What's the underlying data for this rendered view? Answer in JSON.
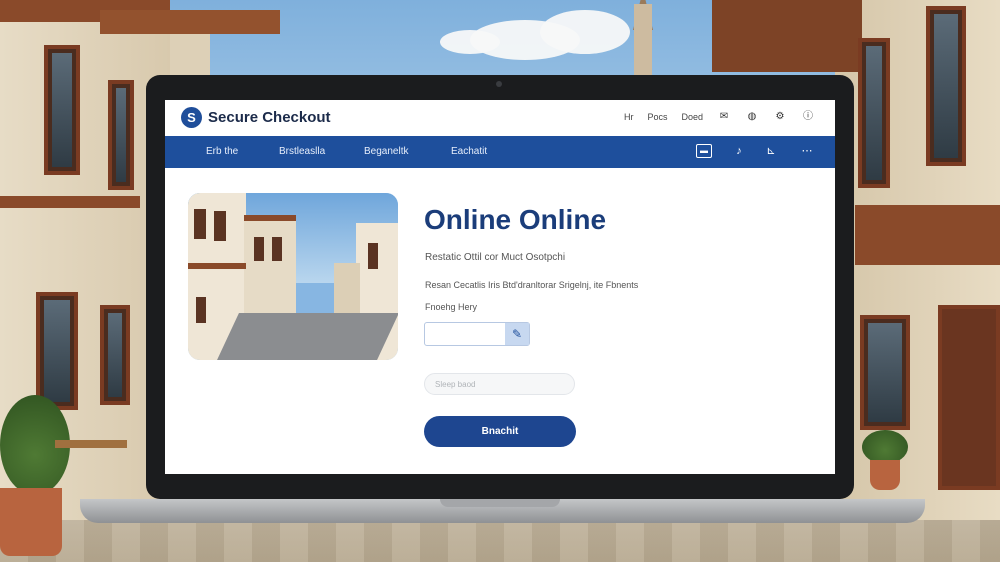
{
  "header": {
    "brand": "Secure Checkout",
    "links": [
      "Hr",
      "Pocs",
      "Doed"
    ],
    "icons": [
      "mail-icon",
      "globe-icon",
      "settings-icon",
      "info-icon"
    ]
  },
  "nav": {
    "items": [
      "Erb the",
      "Brstleaslla",
      "Beganeltk",
      "Eachatit"
    ],
    "icons": [
      "card-icon",
      "bell-icon",
      "cart-icon",
      "more-icon"
    ]
  },
  "main": {
    "title": "Online Online",
    "subtitle": "Restatic Ottil cor Muct Osotpchi",
    "description": "Resan Cecatlis Iris Btd'dranltorar Srigelnj, ite Fbnents",
    "field_label": "Fnoehg Hery",
    "input_value": "",
    "pill_placeholder": "Sleep baod",
    "primary_button": "Bnachit"
  },
  "colors": {
    "primary": "#1e4f9c",
    "title": "#1b3d7a",
    "button": "#1e4690"
  }
}
